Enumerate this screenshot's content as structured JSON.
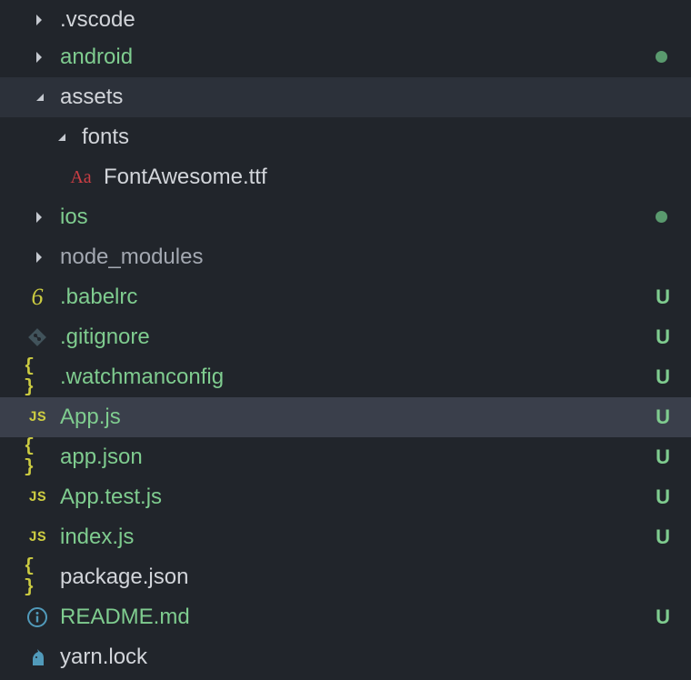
{
  "explorer": {
    "items": [
      {
        "label": ".vscode",
        "kind": "folder",
        "state": "collapsed",
        "color": "normal",
        "badge": ""
      },
      {
        "label": "android",
        "kind": "folder",
        "state": "collapsed",
        "color": "green",
        "badge": "dot"
      },
      {
        "label": "assets",
        "kind": "folder",
        "state": "expanded",
        "color": "normal",
        "badge": ""
      },
      {
        "label": "fonts",
        "kind": "folder",
        "state": "expanded",
        "color": "normal",
        "badge": ""
      },
      {
        "label": "FontAwesome.ttf",
        "kind": "file",
        "icon": "font-file-icon",
        "color": "normal",
        "badge": ""
      },
      {
        "label": "ios",
        "kind": "folder",
        "state": "collapsed",
        "color": "green",
        "badge": "dot"
      },
      {
        "label": "node_modules",
        "kind": "folder",
        "state": "collapsed",
        "color": "gray",
        "badge": ""
      },
      {
        "label": ".babelrc",
        "kind": "file",
        "icon": "babel-icon",
        "color": "green",
        "badge": "U"
      },
      {
        "label": ".gitignore",
        "kind": "file",
        "icon": "git-icon",
        "color": "green",
        "badge": "U"
      },
      {
        "label": ".watchmanconfig",
        "kind": "file",
        "icon": "json-icon",
        "color": "green",
        "badge": "U"
      },
      {
        "label": "App.js",
        "kind": "file",
        "icon": "javascript-icon",
        "color": "green",
        "badge": "U"
      },
      {
        "label": "app.json",
        "kind": "file",
        "icon": "json-icon",
        "color": "green",
        "badge": "U"
      },
      {
        "label": "App.test.js",
        "kind": "file",
        "icon": "javascript-icon",
        "color": "green",
        "badge": "U"
      },
      {
        "label": "index.js",
        "kind": "file",
        "icon": "javascript-icon",
        "color": "green",
        "badge": "U"
      },
      {
        "label": "package.json",
        "kind": "file",
        "icon": "json-icon",
        "color": "normal",
        "badge": ""
      },
      {
        "label": "README.md",
        "kind": "file",
        "icon": "info-icon",
        "color": "green",
        "badge": "U"
      },
      {
        "label": "yarn.lock",
        "kind": "file",
        "icon": "yarn-icon",
        "color": "normal",
        "badge": ""
      }
    ],
    "badge_u": "U",
    "icon_text": {
      "js": "JS",
      "braces": "{ }",
      "six": "6",
      "font": "Aa"
    },
    "colors": {
      "background": "#21252b",
      "hover": "#2c313a",
      "selected": "#3a3f4b",
      "untracked_green": "#7fcc8f",
      "js_yellow": "#cbcb41",
      "font_red": "#cc3e44",
      "info_blue": "#519aba"
    }
  }
}
